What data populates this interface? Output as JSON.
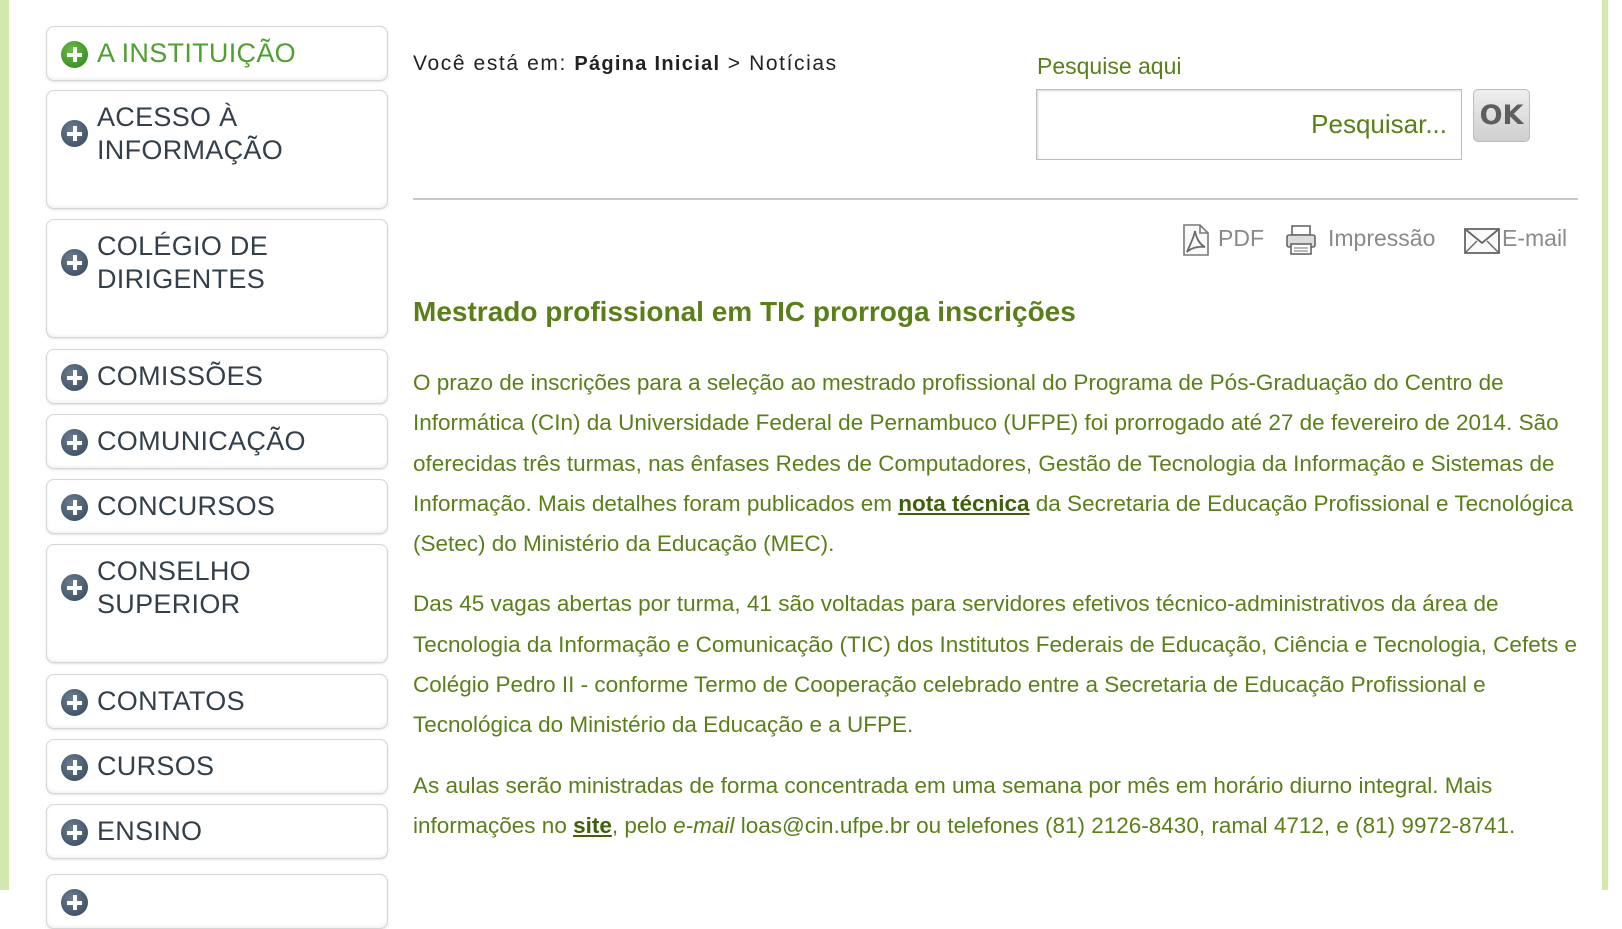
{
  "sidebar": {
    "items": [
      {
        "label": "A INSTITUIÇÃO"
      },
      {
        "label": "ACESSO À\nINFORMAÇÃO"
      },
      {
        "label": "COLÉGIO DE\nDIRIGENTES"
      },
      {
        "label": "COMISSÕES"
      },
      {
        "label": "COMUNICAÇÃO"
      },
      {
        "label": "CONCURSOS"
      },
      {
        "label": "CONSELHO\nSUPERIOR"
      },
      {
        "label": "CONTATOS"
      },
      {
        "label": "CURSOS"
      },
      {
        "label": "ENSINO"
      }
    ]
  },
  "breadcrumb": {
    "prefix": "Você está em:",
    "home": "Página Inicial",
    "separator": ">",
    "current": "Notícias"
  },
  "search": {
    "label": "Pesquise aqui",
    "placeholder": "Pesquisar...",
    "button": "OK"
  },
  "tools": {
    "pdf": "PDF",
    "print": "Impressão",
    "email": "E-mail"
  },
  "article": {
    "title": "Mestrado profissional em TIC prorroga inscrições",
    "p1_before": "O prazo de inscrições para a seleção ao mestrado profissional do Programa de Pós-Graduação do Centro de Informática (CIn) da Universidade Federal de Pernambuco (UFPE) foi prorrogado até 27 de fevereiro de 2014. São oferecidas três turmas, nas ênfases Redes de Computadores, Gestão de Tecnologia da Informação e Sistemas de Informação. Mais detalhes foram publicados em ",
    "p1_link": "nota técnica",
    "p1_after": " da Secretaria de Educação Profissional e Tecnológica (Setec) do Ministério da Educação (MEC).",
    "p2": "Das 45 vagas abertas por turma, 41 são voltadas para servidores efetivos técnico-administrativos da área de Tecnologia da Informação e Comunicação (TIC) dos Institutos Federais de Educação, Ciência e Tecnologia, Cefets e Colégio Pedro II - conforme Termo de Cooperação celebrado entre a Secretaria de Educação Profissional e Tecnológica do Ministério da Educação e a UFPE.",
    "p3_before": "As aulas serão ministradas de forma concentrada em uma semana por mês em horário diurno integral. Mais informações no ",
    "p3_link": "site",
    "p3_mid": ", pelo ",
    "p3_em": "e-mail",
    "p3_after": " loas@cin.ufpe.br ou telefones (81) 2126-8430, ramal 4712, e (81) 9972-8741."
  },
  "colors": {
    "green_text": "#5a7f19",
    "menu_text": "#333f4a",
    "menu_active": "#4ea030",
    "frame": "#d4e7ad"
  }
}
